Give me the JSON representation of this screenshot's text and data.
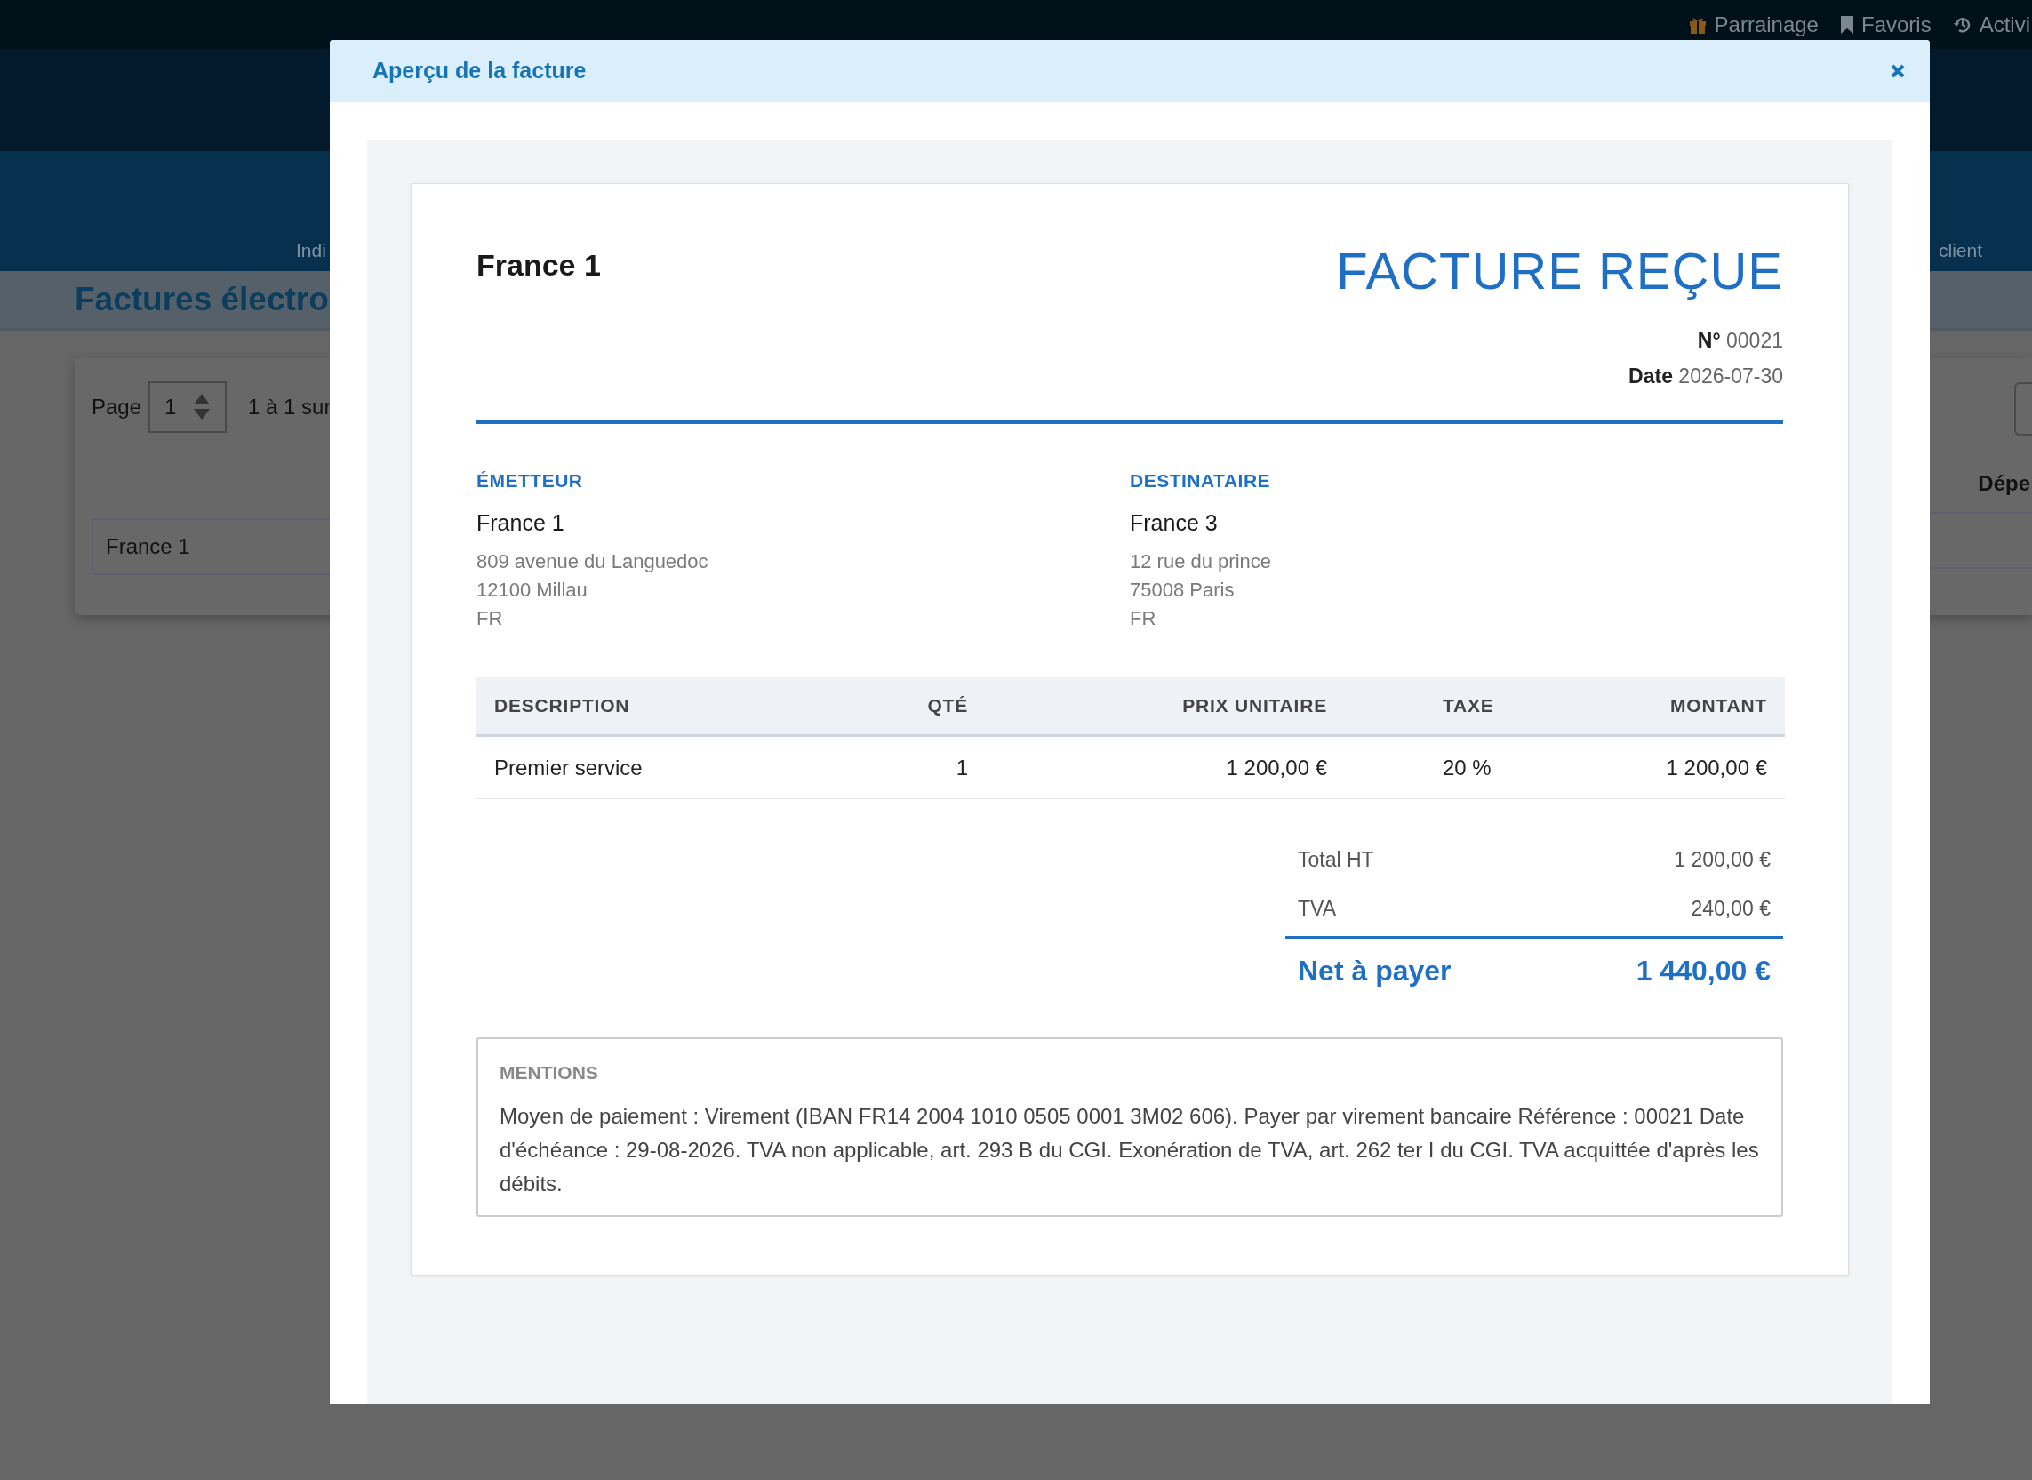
{
  "top_bar": {
    "links": [
      "Parrainage",
      "Favoris",
      "Activi"
    ]
  },
  "nav": {
    "items": [
      "Indi",
      "client"
    ]
  },
  "page_title": "Factures électro",
  "filters": {
    "page_label": "Page",
    "page_value": "1",
    "range_text": "1 à 1 sur",
    "search_value": "France 1",
    "column_label": "Dépe"
  },
  "modal": {
    "title": "Aperçu de la facture",
    "invoice": {
      "seller_name": "France 1",
      "doc_title": "FACTURE REÇUE",
      "number": "**N°** 00021",
      "date": "**Date** 2026-07-30",
      "parties": [
        {
          "heading": "ÉMETTEUR",
          "name": "France 1",
          "address": [
            "809 avenue du Languedoc",
            "12100 Millau",
            "FR"
          ]
        },
        {
          "heading": "DESTINATAIRE",
          "name": "France 3",
          "address": [
            "12 rue du prince",
            "75008 Paris",
            "FR"
          ]
        }
      ],
      "table": {
        "columns": [
          "DESCRIPTION",
          "QTÉ",
          "PRIX UNITAIRE",
          "TAXE",
          "MONTANT"
        ],
        "rows": [
          [
            "Premier service",
            "1",
            "1 200,00 €",
            "20 %",
            "1 200,00 €"
          ]
        ]
      },
      "totals": [
        {
          "kind": "line",
          "label": "Total HT",
          "value": "1 200,00 €"
        },
        {
          "kind": "line",
          "label": "TVA",
          "value": "240,00 €"
        },
        {
          "kind": "grand",
          "label": "Net à payer",
          "value": "1 440,00 €"
        }
      ],
      "mentions": {
        "heading": "MENTIONS",
        "text": "Moyen de paiement : Virement (IBAN FR14 2004 1010 0505 0001 3M02 606). Payer par virement bancaire Référence : 00021 Date d'échéance : 29-08-2026. TVA non applicable, art. 293 B du CGI. Exonération de TVA, art. 262 ter I du CGI. TVA acquittée d'après les débits."
      }
    }
  }
}
